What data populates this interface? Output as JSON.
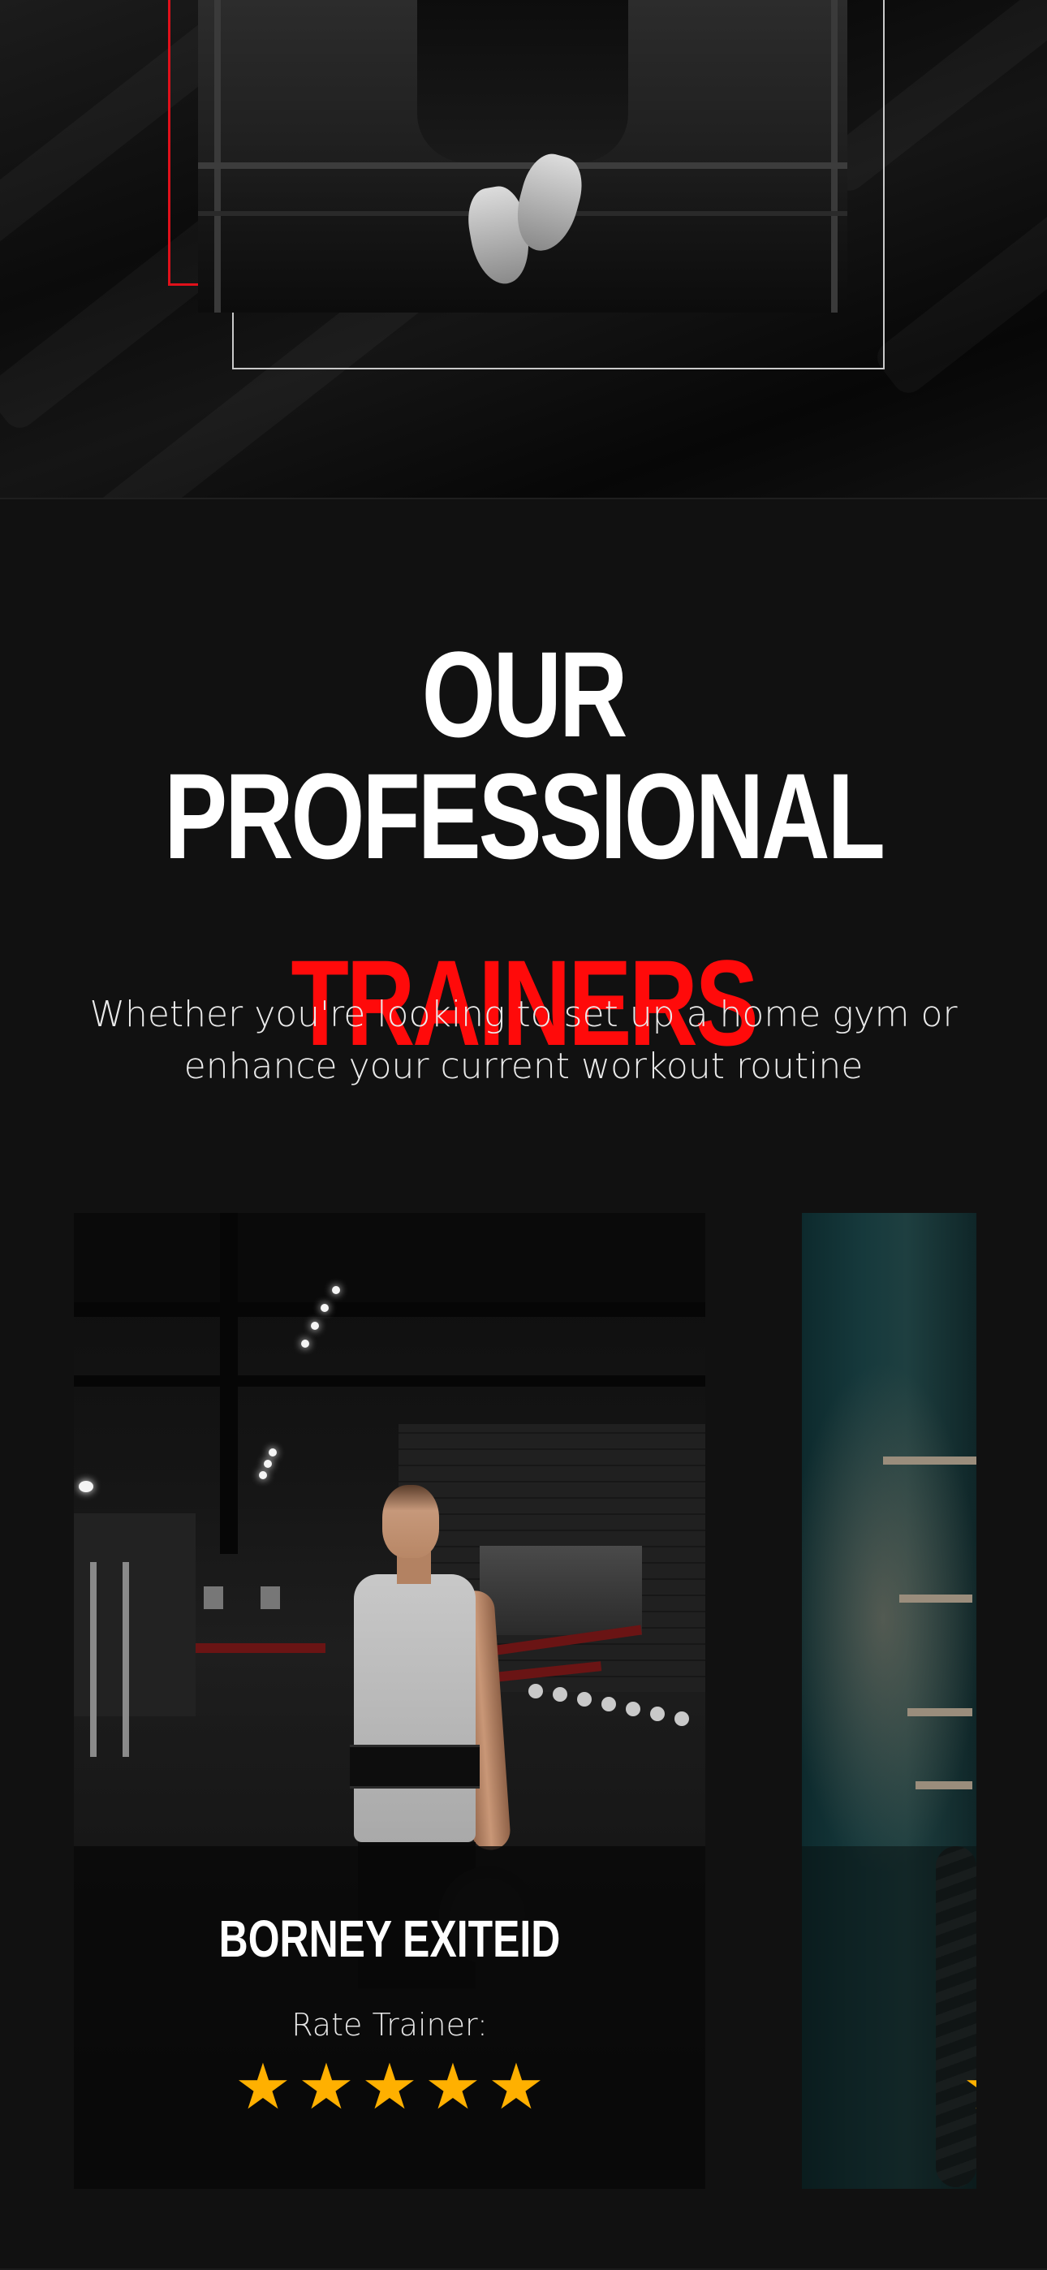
{
  "section": {
    "heading_line1": "OUR PROFESSIONAL",
    "heading_line2": "TRAINERS",
    "subtitle": "Whether you're looking to set up a home gym or enhance your current workout routine"
  },
  "trainers": [
    {
      "name": "BORNEY EXITEID",
      "rate_label": "Rate Trainer:",
      "rating": 5,
      "max_rating": 5
    }
  ],
  "icons": {
    "star": "star-icon"
  },
  "colors": {
    "background": "#111111",
    "accent_red": "#ff0a0a",
    "star": "#ffb000",
    "heading_white": "#ffffff"
  }
}
